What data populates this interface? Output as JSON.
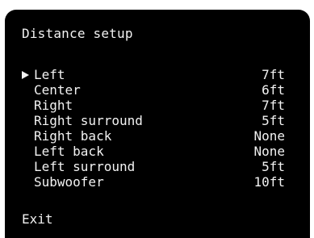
{
  "screen": {
    "title": "Distance setup",
    "menu": [
      {
        "label": "Left",
        "value": "7ft",
        "selected": true
      },
      {
        "label": "Center",
        "value": "6ft",
        "selected": false
      },
      {
        "label": "Right",
        "value": "7ft",
        "selected": false
      },
      {
        "label": "Right surround",
        "value": "5ft",
        "selected": false
      },
      {
        "label": "Right back",
        "value": "None",
        "selected": false
      },
      {
        "label": "Left back",
        "value": "None",
        "selected": false
      },
      {
        "label": "Left surround",
        "value": "5ft",
        "selected": false
      },
      {
        "label": "Subwoofer",
        "value": "10ft",
        "selected": false
      }
    ],
    "exit_label": "Exit",
    "cursor_icon": "play-triangle"
  },
  "colors": {
    "background": "#000000",
    "text": "#f2f2f2"
  }
}
